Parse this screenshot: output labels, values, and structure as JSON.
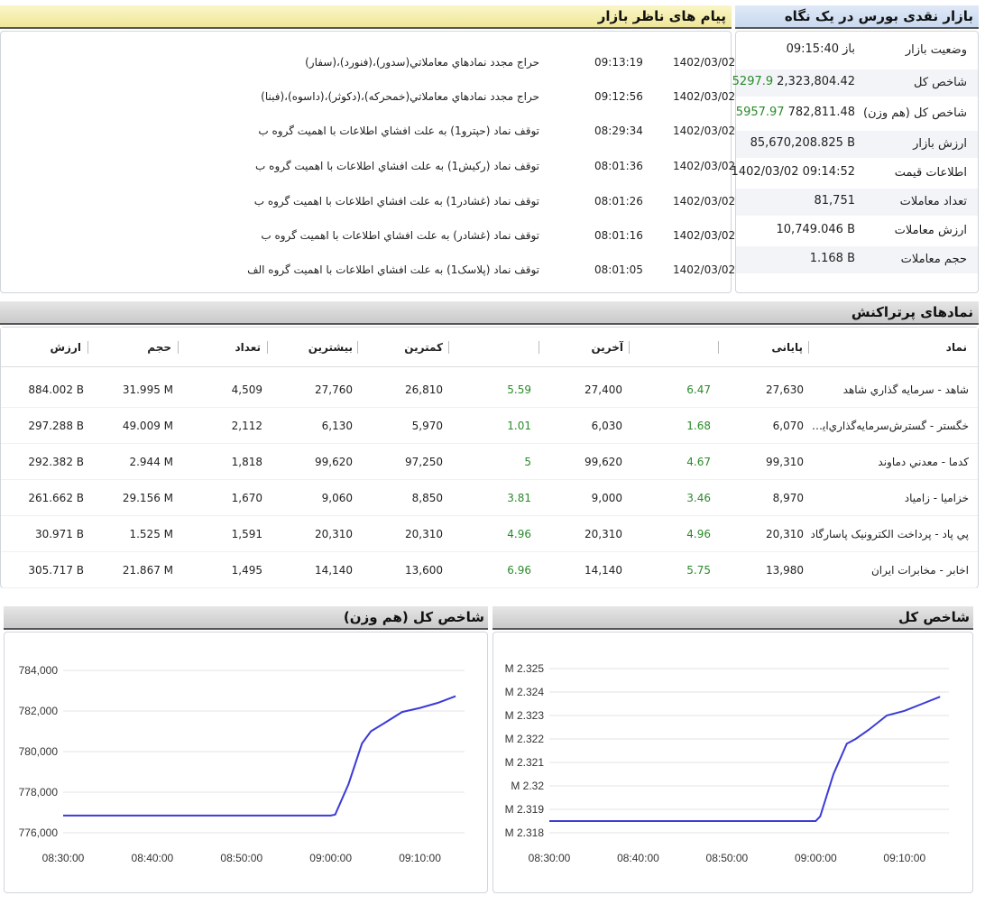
{
  "summary": {
    "title": "بازار نقدی بورس در یک نگاه",
    "rows": [
      {
        "label": "وضعیت بازار",
        "value": "باز 09:15:40",
        "change": ""
      },
      {
        "label": "شاخص کل",
        "value": "2,323,804.42",
        "change": "5297.9"
      },
      {
        "label": "شاخص کل (هم وزن)",
        "value": "782,811.48",
        "change": "5957.97"
      },
      {
        "label": "ارزش بازار",
        "value": "85,670,208.825 B",
        "change": ""
      },
      {
        "label": "اطلاعات قیمت",
        "value": "1402/03/02 09:14:52",
        "change": ""
      },
      {
        "label": "تعداد معاملات",
        "value": "81,751",
        "change": ""
      },
      {
        "label": "ارزش معاملات",
        "value": "10,749.046 B",
        "change": ""
      },
      {
        "label": "حجم معاملات",
        "value": "1.168 B",
        "change": ""
      }
    ]
  },
  "messages": {
    "title": "پیام های ناظر بازار",
    "items": [
      {
        "date": "1402/03/02",
        "time": "09:13:19",
        "text": "حراج مجدد نمادهاي معاملاتي(سدور)،(فنورد)،(سفار)"
      },
      {
        "date": "1402/03/02",
        "time": "09:12:56",
        "text": "حراج مجدد نمادهاي معاملاتي(خمحرکه)،(دکوثر)،(داسوه)،(فبنا)"
      },
      {
        "date": "1402/03/02",
        "time": "08:29:34",
        "text": "توقف نماد (حپترو1) به علت افشاي اطلاعات با اهميت گروه ب"
      },
      {
        "date": "1402/03/02",
        "time": "08:01:36",
        "text": "توقف نماد (رکیش1) به علت افشاي اطلاعات با اهميت گروه ب"
      },
      {
        "date": "1402/03/02",
        "time": "08:01:26",
        "text": "توقف نماد (غشادر1) به علت افشاي اطلاعات با اهميت گروه ب"
      },
      {
        "date": "1402/03/02",
        "time": "08:01:16",
        "text": "توقف نماد (غشادر) به علت افشاي اطلاعات با اهميت گروه ب"
      },
      {
        "date": "1402/03/02",
        "time": "08:01:05",
        "text": "توقف نماد (پلاسک1) به علت افشاي اطلاعات با اهميت گروه الف"
      }
    ]
  },
  "table": {
    "title": "نمادهای پرتراکنش",
    "columns": {
      "name": "نماد",
      "final": "پایانی",
      "last": "آخرین",
      "min": "کمترین",
      "max": "بیشترین",
      "count": "تعداد",
      "volume": "حجم",
      "value": "ارزش"
    },
    "rows": [
      {
        "name": "شاهد - سرمايه گذاري شاهد",
        "final": "27,630",
        "final_pct": "6.47",
        "last": "27,400",
        "last_pct": "5.59",
        "min": "26,810",
        "max": "27,760",
        "count": "4,509",
        "volume": "31.995 M",
        "value": "884.002 B"
      },
      {
        "name": "خگستر - گسترش‌سرمايه‌گذاري‌ايرا...",
        "final": "6,070",
        "final_pct": "1.68",
        "last": "6,030",
        "last_pct": "1.01",
        "min": "5,970",
        "max": "6,130",
        "count": "2,112",
        "volume": "49.009 M",
        "value": "297.288 B"
      },
      {
        "name": "کدما - معدني دماوند",
        "final": "99,310",
        "final_pct": "4.67",
        "last": "99,620",
        "last_pct": "5",
        "min": "97,250",
        "max": "99,620",
        "count": "1,818",
        "volume": "2.944 M",
        "value": "292.382 B"
      },
      {
        "name": "خزاميا - زامياد",
        "final": "8,970",
        "final_pct": "3.46",
        "last": "9,000",
        "last_pct": "3.81",
        "min": "8,850",
        "max": "9,060",
        "count": "1,670",
        "volume": "29.156 M",
        "value": "261.662 B"
      },
      {
        "name": "پي پاد - پرداخت الکترونيک پاسارگاد",
        "final": "20,310",
        "final_pct": "4.96",
        "last": "20,310",
        "last_pct": "4.96",
        "min": "20,310",
        "max": "20,310",
        "count": "1,591",
        "volume": "1.525 M",
        "value": "30.971 B"
      },
      {
        "name": "اخابر - مخابرات ايران",
        "final": "13,980",
        "final_pct": "5.75",
        "last": "14,140",
        "last_pct": "6.96",
        "min": "13,600",
        "max": "14,140",
        "count": "1,495",
        "volume": "21.867 M",
        "value": "305.717 B"
      }
    ]
  },
  "chart_data": [
    {
      "type": "line",
      "title": "شاخص کل (هم وزن)",
      "x_ticks": [
        "08:30:00",
        "08:40:00",
        "08:50:00",
        "09:00:00",
        "09:10:00"
      ],
      "y_ticks": [
        "776,000",
        "778,000",
        "780,000",
        "782,000",
        "784,000"
      ],
      "ylim": [
        776000,
        784000
      ],
      "xlim_minutes": [
        0,
        45
      ],
      "line_color": "#3b3bd6",
      "points": [
        [
          0,
          776850
        ],
        [
          30,
          776850
        ],
        [
          30.5,
          776900
        ],
        [
          32,
          778400
        ],
        [
          33.5,
          780400
        ],
        [
          34.5,
          781000
        ],
        [
          36,
          781400
        ],
        [
          38,
          781950
        ],
        [
          40,
          782150
        ],
        [
          42,
          782400
        ],
        [
          44,
          782730
        ]
      ]
    },
    {
      "type": "line",
      "title": "شاخص کل",
      "x_ticks": [
        "08:30:00",
        "08:40:00",
        "08:50:00",
        "09:00:00",
        "09:10:00"
      ],
      "y_ticks": [
        "M 2.318",
        "M 2.319",
        "M 2.32",
        "M 2.321",
        "M 2.322",
        "M 2.323",
        "M 2.324",
        "M 2.325"
      ],
      "ylim": [
        2.318,
        2.325
      ],
      "xlim_minutes": [
        0,
        45
      ],
      "line_color": "#3b3bd6",
      "points": [
        [
          0,
          2.3185
        ],
        [
          30,
          2.3185
        ],
        [
          30.5,
          2.3187
        ],
        [
          32,
          2.3205
        ],
        [
          33.5,
          2.3218
        ],
        [
          34.5,
          2.322
        ],
        [
          36,
          2.3224
        ],
        [
          38,
          2.323
        ],
        [
          40,
          2.3232
        ],
        [
          42,
          2.3235
        ],
        [
          44,
          2.3238
        ]
      ]
    }
  ]
}
